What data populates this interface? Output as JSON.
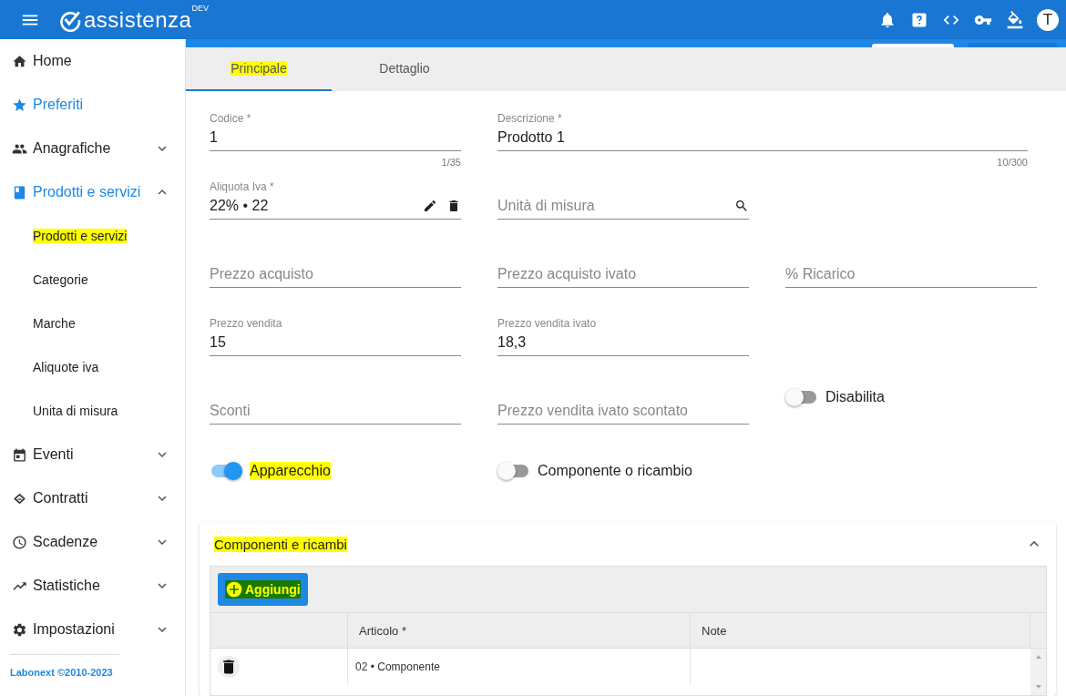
{
  "topbar": {
    "brand": "assistenza",
    "badge": "DEV",
    "avatar": "T"
  },
  "sidebar": {
    "items": [
      {
        "label": "Home",
        "selected": false
      },
      {
        "label": "Preferiti",
        "selected": true
      },
      {
        "label": "Anagrafiche",
        "selected": false,
        "expanded": false
      },
      {
        "label": "Prodotti e servizi",
        "selected": true,
        "expanded": true,
        "children": [
          {
            "label": "Prodotti e servizi",
            "highlighted": true
          },
          {
            "label": "Categorie",
            "highlighted": false
          },
          {
            "label": "Marche",
            "highlighted": false
          },
          {
            "label": "Aliquote iva",
            "highlighted": false
          },
          {
            "label": "Unita di misura",
            "highlighted": false
          }
        ]
      },
      {
        "label": "Eventi",
        "selected": false,
        "expanded": false
      },
      {
        "label": "Contratti",
        "selected": false,
        "expanded": false
      },
      {
        "label": "Scadenze",
        "selected": false,
        "expanded": false
      },
      {
        "label": "Statistiche",
        "selected": false,
        "expanded": false
      },
      {
        "label": "Impostazioni",
        "selected": false,
        "expanded": false
      }
    ],
    "footer": "Labonext ©2010-2023"
  },
  "tabs": [
    {
      "label": "Principale",
      "selected": true,
      "highlighted": true
    },
    {
      "label": "Dettaglio",
      "selected": false,
      "highlighted": false
    }
  ],
  "form": {
    "rows": [
      [
        {
          "kind": "field",
          "label": "Codice *",
          "value": "1",
          "counter": "1/35"
        },
        {
          "kind": "wide-field",
          "label": "Descrizione *",
          "value": "Prodotto 1",
          "counter": "10/300"
        }
      ],
      [
        {
          "kind": "select-field",
          "label": "Aliquota Iva *",
          "value": "22% • 22"
        },
        {
          "kind": "search-field",
          "placeholder": "Unità di misura"
        }
      ],
      [
        {
          "kind": "field",
          "placeholder": "Prezzo acquisto"
        },
        {
          "kind": "field",
          "placeholder": "Prezzo acquisto ivato"
        },
        {
          "kind": "field",
          "placeholder": "% Ricarico"
        }
      ],
      [
        {
          "kind": "field",
          "label": "Prezzo vendita",
          "value": "15"
        },
        {
          "kind": "field",
          "label": "Prezzo vendita ivato",
          "value": "18,3"
        }
      ],
      [
        {
          "kind": "field",
          "placeholder": "Sconti"
        },
        {
          "kind": "field",
          "placeholder": "Prezzo vendita ivato scontato"
        },
        {
          "kind": "toggle",
          "label": "Disabilita",
          "on": false,
          "highlighted": false
        }
      ],
      [
        {
          "kind": "toggle",
          "label": "Apparecchio",
          "on": true,
          "highlighted": true
        },
        {
          "kind": "toggle",
          "label": "Componente o ricambio",
          "on": false,
          "highlighted": false
        }
      ]
    ]
  },
  "section": {
    "title": "Componenti e ricambi",
    "title_highlighted": true,
    "expanded": true,
    "add_button": {
      "label": "Aggiungi",
      "highlighted": true
    },
    "columns": [
      "Articolo *",
      "Note"
    ],
    "rows": [
      {
        "articolo": "02 • Componente"
      }
    ]
  }
}
